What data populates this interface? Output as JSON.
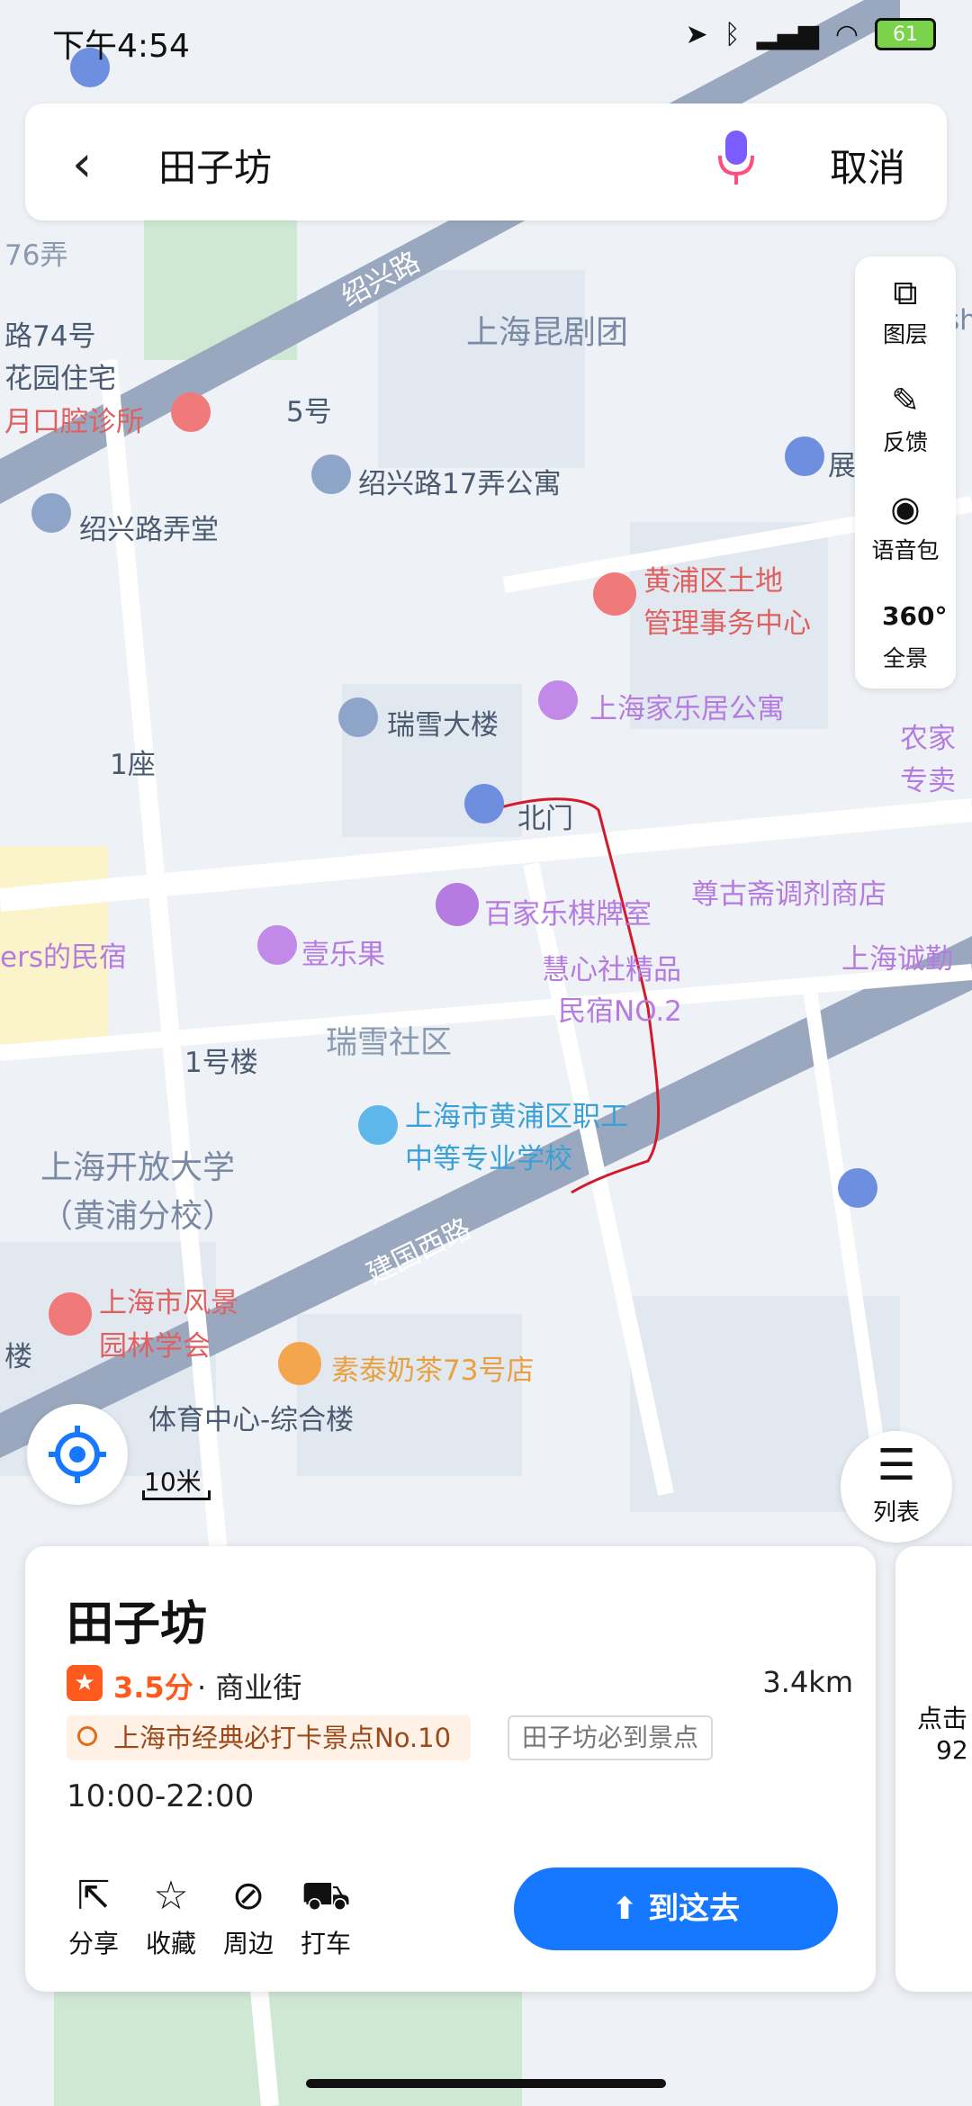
{
  "status": {
    "time": "下午4:54",
    "battery": "61"
  },
  "search": {
    "query": "田子坊",
    "cancel": "取消"
  },
  "tools": [
    {
      "label": "图层",
      "icon": "layers-icon"
    },
    {
      "label": "反馈",
      "icon": "feedback-icon"
    },
    {
      "label": "语音包",
      "icon": "voice-pack-icon"
    },
    {
      "label": "全景",
      "icon": "panorama-360-icon"
    }
  ],
  "map": {
    "labels": {
      "l1": "76弄",
      "l2": "路74号",
      "l3": "花园住宅",
      "l4": "月口腔诊所",
      "l5": "绍兴路",
      "l6": "上海昆剧团",
      "l7": "5号",
      "l8": "绍兴路17弄公寓",
      "l9": "绍兴路弄堂",
      "l10": "黄浦区土地",
      "l11": "管理事务中心",
      "l12": "瑞雪大楼",
      "l13": "上海家乐居公寓",
      "l14": "1座",
      "l15": "北门",
      "l16": "百家乐棋牌室",
      "l17": "尊古斋调剂商店",
      "l18": "ers的民宿",
      "l19": "壹乐果",
      "l20": "慧心社精品",
      "l21": "民宿NO.2",
      "l22": "上海诚勤",
      "l23": "1号楼",
      "l24": "瑞雪社区",
      "l25": "上海市黄浦区职工",
      "l26": "中等专业学校",
      "l27": "上海开放大学",
      "l28": "（黄浦分校）",
      "l29": "建国西路",
      "l30": "上海市风景",
      "l31": "园林学会",
      "l32": "素泰奶茶73号店",
      "l33": "楼",
      "l34": "体育中心-综合楼",
      "l35": "农家",
      "l36": "专卖",
      "l37": "sh",
      "l38": "展"
    },
    "scale": "10米",
    "list_label": "列表"
  },
  "card": {
    "title": "田子坊",
    "score": "3.5分",
    "category": "· 商业街",
    "distance": "3.4km",
    "tag1": "上海市经典必打卡景点No.10",
    "tag2": "田子坊必到景点",
    "hours": "10:00-22:00",
    "actions": [
      {
        "label": "分享",
        "icon": "share-icon"
      },
      {
        "label": "收藏",
        "icon": "star-icon"
      },
      {
        "label": "周边",
        "icon": "compass-icon"
      },
      {
        "label": "打车",
        "icon": "taxi-icon"
      }
    ],
    "goto": "到这去"
  },
  "card2": {
    "t1": "点击",
    "t2": "92"
  },
  "colors": {
    "accent": "#1677ff",
    "rating": "#ff5a1e"
  }
}
